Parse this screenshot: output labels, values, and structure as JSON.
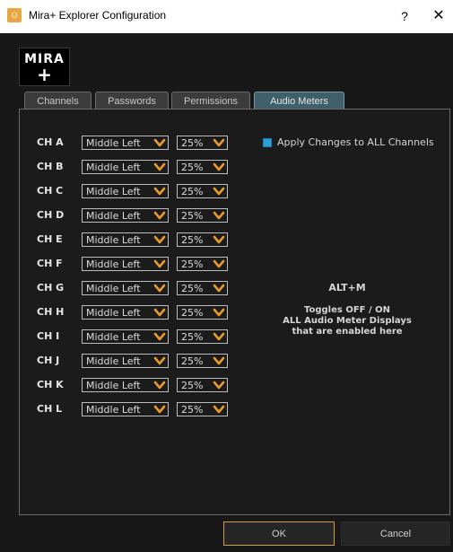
{
  "window": {
    "title": "Mira+ Explorer Configuration",
    "help_label": "?",
    "close_label": "✕"
  },
  "logo": {
    "line1": "MIRA",
    "line2": "+"
  },
  "tabs": [
    {
      "label": "Channels",
      "active": false
    },
    {
      "label": "Passwords",
      "active": false
    },
    {
      "label": "Permissions",
      "active": false
    },
    {
      "label": "Audio Meters",
      "active": true
    }
  ],
  "channels": [
    {
      "label": "CH A",
      "position": "Middle Left",
      "size": "25%"
    },
    {
      "label": "CH B",
      "position": "Middle Left",
      "size": "25%"
    },
    {
      "label": "CH C",
      "position": "Middle Left",
      "size": "25%"
    },
    {
      "label": "CH D",
      "position": "Middle Left",
      "size": "25%"
    },
    {
      "label": "CH E",
      "position": "Middle Left",
      "size": "25%"
    },
    {
      "label": "CH F",
      "position": "Middle Left",
      "size": "25%"
    },
    {
      "label": "CH G",
      "position": "Middle Left",
      "size": "25%"
    },
    {
      "label": "CH H",
      "position": "Middle Left",
      "size": "25%"
    },
    {
      "label": "CH I",
      "position": "Middle Left",
      "size": "25%"
    },
    {
      "label": "CH J",
      "position": "Middle Left",
      "size": "25%"
    },
    {
      "label": "CH K",
      "position": "Middle Left",
      "size": "25%"
    },
    {
      "label": "CH L",
      "position": "Middle Left",
      "size": "25%"
    }
  ],
  "apply_all": {
    "label": "Apply Changes to ALL Channels",
    "checked": true
  },
  "shortcut_note": {
    "key": "ALT+M",
    "line1": "Toggles OFF / ON",
    "line2": "ALL Audio Meter Displays",
    "line3": "that are enabled here"
  },
  "buttons": {
    "ok": "OK",
    "cancel": "Cancel"
  },
  "colors": {
    "accent": "#e89a2c",
    "tab_active": "#3f5f6b",
    "checkbox": "#2a9fd6",
    "ok_border": "#d79a3a"
  }
}
